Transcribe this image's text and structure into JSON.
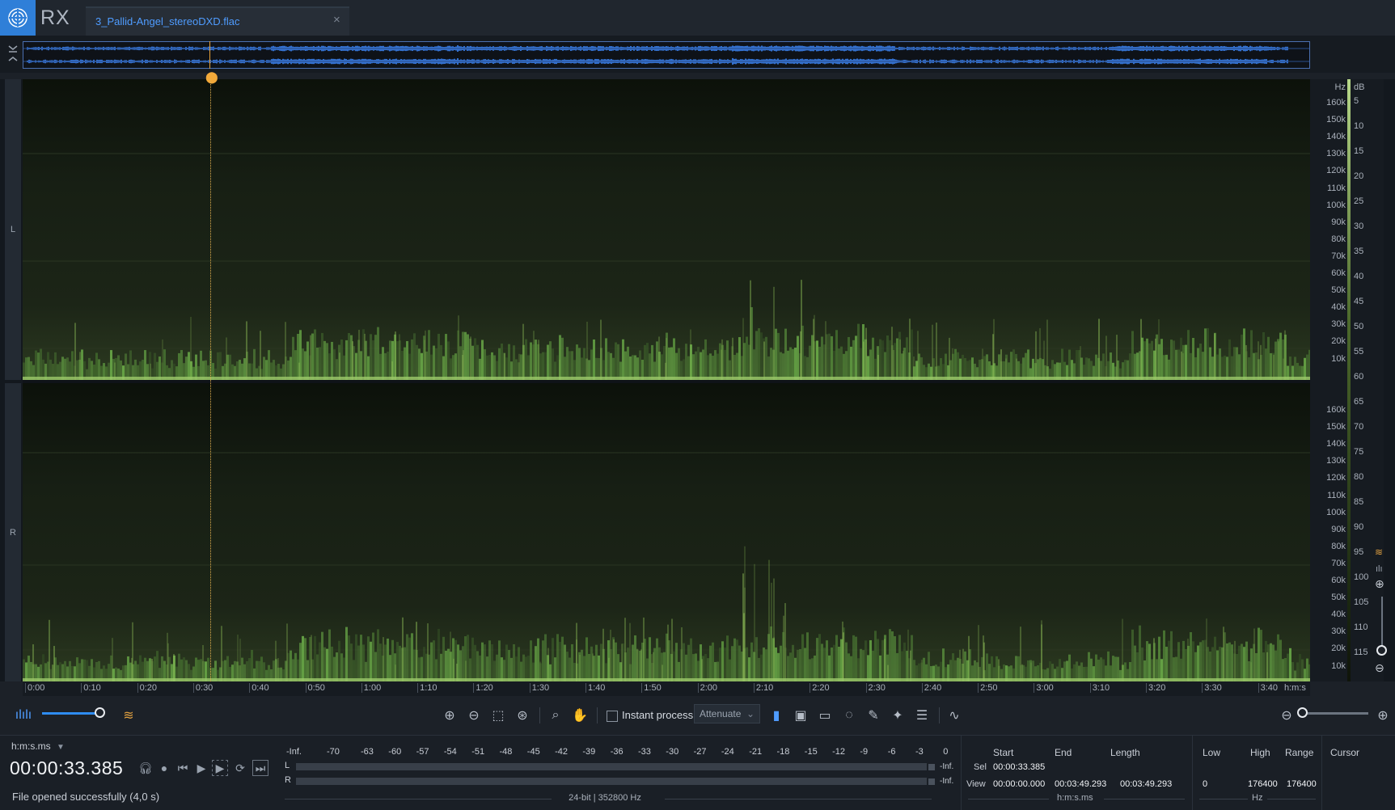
{
  "app": {
    "name": "RX",
    "logo": "izotope-logo-icon"
  },
  "tab": {
    "title": "3_Pallid-Angel_stereoDXD.flac",
    "close": "×"
  },
  "channels": {
    "left": "L",
    "right": "R"
  },
  "freq_axis": {
    "unit": "Hz",
    "left_ticks": [
      "160k",
      "150k",
      "140k",
      "130k",
      "120k",
      "110k",
      "100k",
      "90k",
      "80k",
      "70k",
      "60k",
      "50k",
      "40k",
      "30k",
      "20k",
      "10k"
    ],
    "right_ticks": [
      "160k",
      "150k",
      "140k",
      "130k",
      "120k",
      "110k",
      "100k",
      "90k",
      "80k",
      "70k",
      "60k",
      "50k",
      "40k",
      "30k",
      "20k",
      "10k"
    ]
  },
  "db_axis": {
    "unit": "dB",
    "ticks": [
      "5",
      "10",
      "15",
      "20",
      "25",
      "30",
      "35",
      "40",
      "45",
      "50",
      "55",
      "60",
      "65",
      "70",
      "75",
      "80",
      "85",
      "90",
      "95",
      "100",
      "105",
      "110",
      "115"
    ]
  },
  "timeline": {
    "labels": [
      "0:00",
      "0:10",
      "0:20",
      "0:30",
      "0:40",
      "0:50",
      "1:00",
      "1:10",
      "1:20",
      "1:30",
      "1:40",
      "1:50",
      "2:00",
      "2:10",
      "2:20",
      "2:30",
      "2:40",
      "2:50",
      "3:00",
      "3:10",
      "3:20",
      "3:30",
      "3:40"
    ],
    "unit": "h:m:s"
  },
  "toolbar": {
    "instant_process_label": "Instant process",
    "instant_process_checked": false,
    "mode_value": "Attenuate",
    "volume_level_fraction": 0.85
  },
  "transport": {
    "time_format": "h:m:s.ms",
    "current_time": "00:00:33.385",
    "status": "File opened successfully (4,0 s)"
  },
  "meter": {
    "scale": [
      "-Inf.",
      "-70",
      "-63",
      "-60",
      "-57",
      "-54",
      "-51",
      "-48",
      "-45",
      "-42",
      "-39",
      "-36",
      "-33",
      "-30",
      "-27",
      "-24",
      "-21",
      "-18",
      "-15",
      "-12",
      "-9",
      "-6",
      "-3",
      "0"
    ],
    "channels": [
      {
        "name": "L",
        "peak": "-Inf."
      },
      {
        "name": "R",
        "peak": "-Inf."
      }
    ],
    "format_info": "24-bit | 352800 Hz"
  },
  "selection": {
    "headers": {
      "start": "Start",
      "end": "End",
      "length": "Length"
    },
    "sel": {
      "label": "Sel",
      "start": "00:00:33.385",
      "end": "",
      "length": ""
    },
    "view": {
      "label": "View",
      "start": "00:00:00.000",
      "end": "00:03:49.293",
      "length": "00:03:49.293"
    },
    "unit": "h:m:s.ms"
  },
  "frequency": {
    "headers": {
      "low": "Low",
      "high": "High",
      "range": "Range"
    },
    "view": {
      "low": "0",
      "high": "176400",
      "range": "176400"
    },
    "unit": "Hz"
  },
  "cursor": {
    "header": "Cursor"
  },
  "colors": {
    "accent": "#2f7fd8",
    "spectrogram": "#7fb04a",
    "playhead": "#f2a93a",
    "tab_text": "#4f9cff"
  }
}
